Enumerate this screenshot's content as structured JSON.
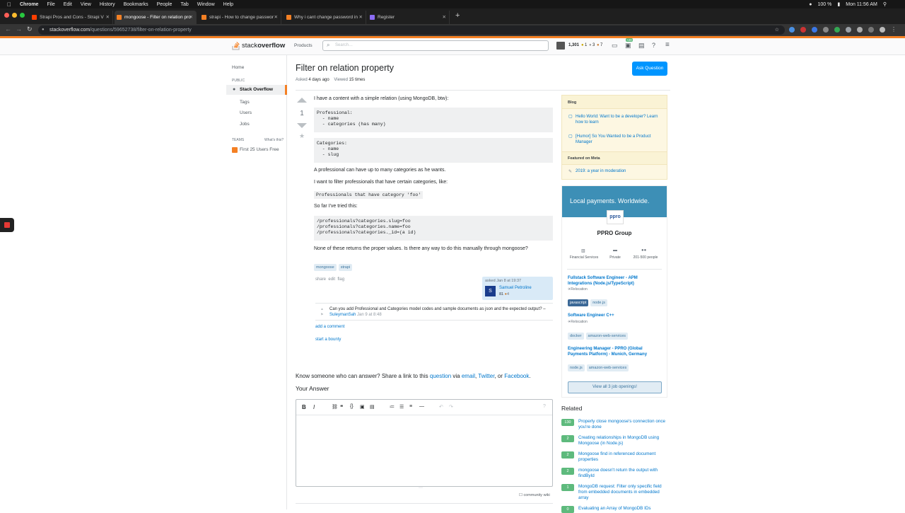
{
  "macbar": {
    "app": "Chrome",
    "menus": [
      "File",
      "Edit",
      "View",
      "History",
      "Bookmarks",
      "People",
      "Tab",
      "Window",
      "Help"
    ],
    "battery": "100 %",
    "time": "Mon 11:56 AM"
  },
  "tabs": [
    {
      "title": "Strapi Pros and Cons - Strapi V",
      "fav": "#ff3e00"
    },
    {
      "title": "mongoose - Filter on relation pro",
      "fav": "#f48024"
    },
    {
      "title": "strapi - How to change passwor",
      "fav": "#f48024"
    },
    {
      "title": "Why i cant change password in",
      "fav": "#f48024"
    },
    {
      "title": "Register",
      "fav": "#8c6cf4"
    }
  ],
  "url": {
    "host": "stackoverflow.com",
    "path": "/questions/59652738/filter-on-relation-property"
  },
  "header": {
    "products": "Products",
    "search_placeholder": "Search…",
    "rep": "1,301",
    "gold": "1",
    "silver": "3",
    "bronze": "7",
    "review_badge": "+20"
  },
  "nav": {
    "home": "Home",
    "public": "PUBLIC",
    "stack": "Stack Overflow",
    "tags": "Tags",
    "users": "Users",
    "jobs": "Jobs",
    "teams": "TEAMS",
    "whats": "What's this?",
    "free": "First 25 Users Free"
  },
  "question": {
    "title": "Filter on relation property",
    "asked_label": "Asked",
    "asked": "4 days ago",
    "viewed_label": "Viewed",
    "viewed": "15 times",
    "ask_button": "Ask Question",
    "votes": "1",
    "p1": "I have a content with a simple relation (using MongoDB, btw):",
    "code1": "Professional:\n  - name\n  - categories (has many)",
    "code2": "Categories:\n  - name\n  - slug",
    "p2": "A professional can have up to many categories as he wants.",
    "p3": "I want to filter professionals that have certain categories, like:",
    "inline_code": "Professionals that have category 'foo'",
    "p4": "So far I've tried this:",
    "code3": "/professionals?categories.slug=foo\n/professionals?categories.name=foo\n/professionals?categories._id=(a id)",
    "p5": "None of these returns the proper values. Is there any way to do this manually through mongoose?",
    "tags": [
      "mongoose",
      "strapi"
    ],
    "actions": [
      "share",
      "edit",
      "flag"
    ],
    "asked_card": "asked Jan 8 at 19:37",
    "user": "Samuel Petroline",
    "user_rep": "81",
    "user_bronze": "4",
    "comment": "Can you add Professional and Categories model codes and sample documents as json and the expected output? –",
    "comment_user": "SuleymanSah",
    "comment_date": "Jan 9 at 8:48",
    "add_comment": "add a comment",
    "bounty": "start a bounty"
  },
  "share": {
    "pre": "Know someone who can answer? Share a link to this",
    "question": "question",
    "via": "via",
    "email": "email",
    "twitter": "Twitter",
    "or": "or",
    "facebook": "Facebook"
  },
  "answer": {
    "heading": "Your Answer",
    "wiki": "community wiki"
  },
  "blog": {
    "title": "Blog",
    "item1": "Hello World: Want to be a developer? Learn how to learn",
    "item2": "[Humor] So You Wanted to be a Product Manager",
    "meta_title": "Featured on Meta",
    "meta1": "2019: a year in moderation"
  },
  "ad": {
    "banner": "Local payments. Worldwide.",
    "logo": "ppro",
    "company": "PPRO Group",
    "facts": [
      "Financial Services",
      "Private",
      "201-500 people"
    ],
    "jobs": [
      {
        "title": "Fullstack Software Engineer - APM Integrations (Node.js/TypeScript)",
        "loc": "Relocation",
        "tags": [
          "javascript",
          "node.js"
        ]
      },
      {
        "title": "Software Engineer C++",
        "loc": "Relocation",
        "tags": [
          "docker",
          "amazon-web-services"
        ]
      },
      {
        "title": "Engineering Manager - PPRO (Global Payments Platform) - Munich, Germany",
        "loc": "",
        "tags": [
          "node.js",
          "amazon-web-services"
        ]
      }
    ],
    "view_all": "View all 3 job openings!"
  },
  "related": {
    "title": "Related",
    "items": [
      {
        "score": "130",
        "text": "Properly close mongoose's connection once you're done"
      },
      {
        "score": "2",
        "text": "Creating relationships in MongoDB using Mongoose (in Node.js)"
      },
      {
        "score": "2",
        "text": "Mongoose find in referenced document properties"
      },
      {
        "score": "2",
        "text": "mongoose doesn't return the output with findById"
      },
      {
        "score": "1",
        "text": "MongoDB request: Filter only specific field from embedded documents in embedded array"
      },
      {
        "score": "0",
        "text": "Evaluating an Array of MongoDB IDs"
      }
    ]
  },
  "colors": {
    "accent": "#f48024",
    "link": "#0077cc",
    "button": "#0095ff",
    "score": "#5eba7d"
  }
}
